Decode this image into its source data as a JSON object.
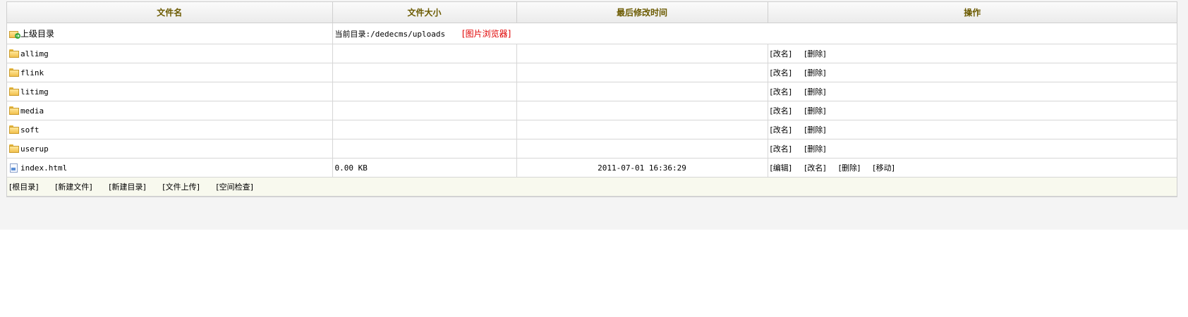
{
  "headers": {
    "name": "文件名",
    "size": "文件大小",
    "modified": "最后修改时间",
    "actions": "操作"
  },
  "parent_row": {
    "label": "上级目录",
    "current_dir": "当前目录:/dedecms/uploads",
    "image_browser": "[图片浏览器]"
  },
  "folders": [
    {
      "name": "allimg",
      "rename": "[改名]",
      "delete": "[删除]"
    },
    {
      "name": "flink",
      "rename": "[改名]",
      "delete": "[删除]"
    },
    {
      "name": "litimg",
      "rename": "[改名]",
      "delete": "[删除]"
    },
    {
      "name": "media",
      "rename": "[改名]",
      "delete": "[删除]"
    },
    {
      "name": "soft",
      "rename": "[改名]",
      "delete": "[删除]"
    },
    {
      "name": "userup",
      "rename": "[改名]",
      "delete": "[删除]"
    }
  ],
  "file": {
    "name": "index.html",
    "size": "0.00 KB",
    "modified": "2011-07-01 16:36:29",
    "edit": "[编辑]",
    "rename": "[改名]",
    "delete": "[删除]",
    "move": "[移动]"
  },
  "footer": {
    "root": "[根目录]",
    "new_file": "[新建文件]",
    "new_dir": "[新建目录]",
    "upload": "[文件上传]",
    "space_check": "[空间检查]"
  },
  "colors": {
    "header_text": "#6b5a00",
    "red_link": "#e00000",
    "footer_bg": "#f8f9ee",
    "page_bg": "#f4f4f4"
  }
}
